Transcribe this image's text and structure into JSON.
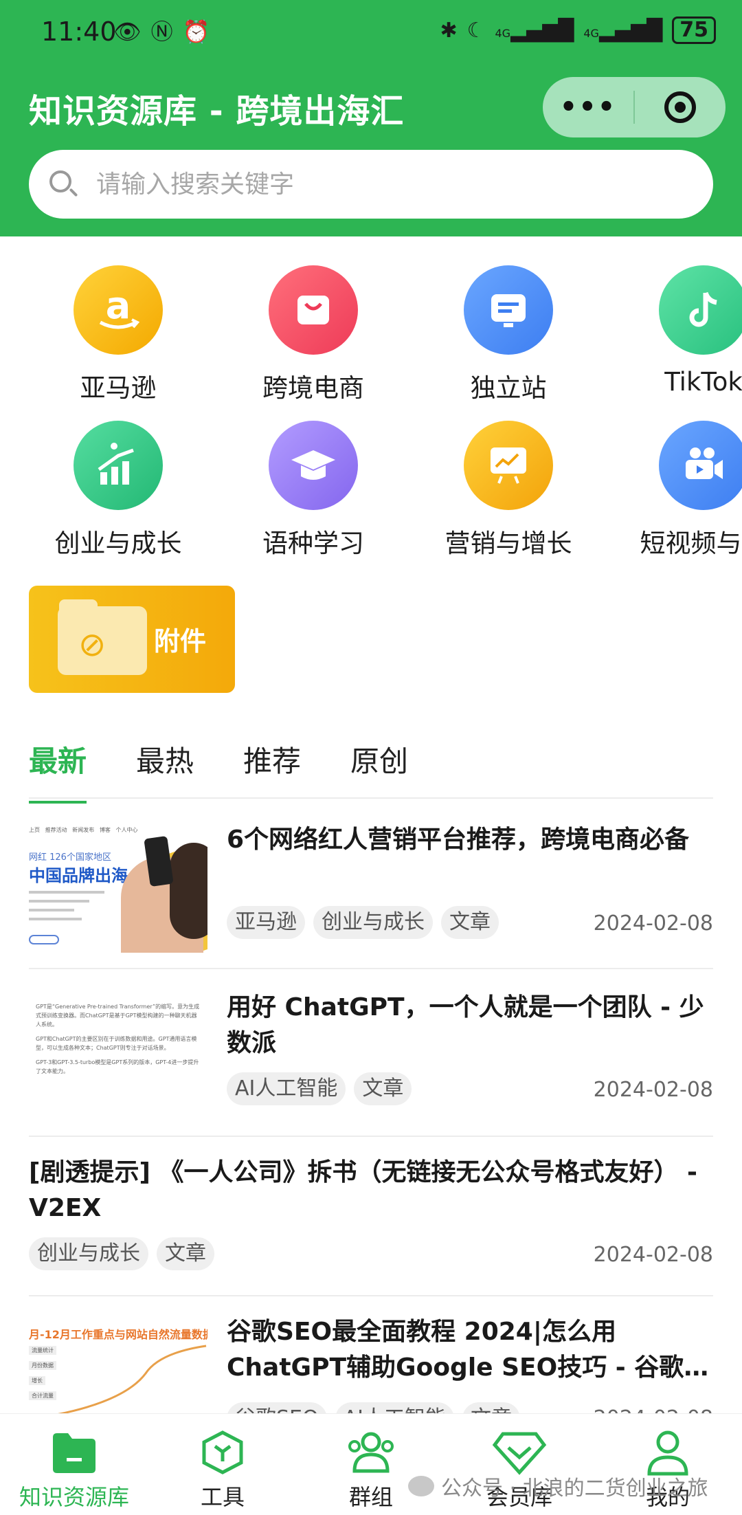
{
  "status_bar": {
    "time": "11:40",
    "battery": "75",
    "network_1": "4G",
    "network_2": "4G"
  },
  "header": {
    "title": "知识资源库 - 跨境出海汇",
    "search_placeholder": "请输入搜索关键字"
  },
  "categories": [
    {
      "label": "亚马逊",
      "icon": "amazon-icon",
      "color": "#f5b800"
    },
    {
      "label": "跨境电商",
      "icon": "shopping-bag-icon",
      "color": "#f2445d"
    },
    {
      "label": "独立站",
      "icon": "monitor-icon",
      "color": "#4f8ef7"
    },
    {
      "label": "TikTok",
      "icon": "tiktok-icon",
      "color": "#3fd08f"
    },
    {
      "label": "创业与成长",
      "icon": "growth-chart-icon",
      "color": "#30c783"
    },
    {
      "label": "语种学习",
      "icon": "graduation-cap-icon",
      "color": "#9b7ff0"
    },
    {
      "label": "营销与增长",
      "icon": "presentation-icon",
      "color": "#f6b20c"
    },
    {
      "label": "短视频与直",
      "icon": "video-camera-icon",
      "color": "#4f8ef7"
    }
  ],
  "attachment_banner": {
    "label": "附件"
  },
  "tabs": [
    "最新",
    "最热",
    "推荐",
    "原创"
  ],
  "articles": [
    {
      "title": "6个网络红人营销平台推荐，跨境电商必备",
      "tags": [
        "亚马逊",
        "创业与成长",
        "文章"
      ],
      "date": "2024-02-08",
      "thumb_text": {
        "sub": "网红 126个国家地区",
        "big": "中国品牌出海"
      }
    },
    {
      "title": "用好 ChatGPT，一个人就是一个团队 - 少数派",
      "tags": [
        "AI人工智能",
        "文章"
      ],
      "date": "2024-02-08"
    },
    {
      "title": "[剧透提示] 《一人公司》拆书（无链接无公众号格式友好） - V2EX",
      "tags": [
        "创业与成长",
        "文章"
      ],
      "date": "2024-02-08"
    },
    {
      "title": "谷歌SEO最全面教程 2024|怎么用ChatGPT辅助Google SEO技巧 - 谷歌…",
      "tags": [
        "谷歌SEO",
        "AI人工智能",
        "文章"
      ],
      "date": "2024-02-08",
      "thumb_text": {
        "head": "月-12月工作重点与网站自然流量数据"
      }
    }
  ],
  "bottom_nav": [
    {
      "label": "知识资源库",
      "icon": "folder-icon",
      "active": true
    },
    {
      "label": "工具",
      "icon": "cube-icon",
      "active": false
    },
    {
      "label": "群组",
      "icon": "group-icon",
      "active": false
    },
    {
      "label": "会员库",
      "icon": "diamond-icon",
      "active": false
    },
    {
      "label": "我的",
      "icon": "person-icon",
      "active": false
    }
  ],
  "watermark": "公众号 · 北浪的二货创业之旅",
  "colors": {
    "brand_green": "#2db553",
    "capsule": "#a6e2bb"
  }
}
